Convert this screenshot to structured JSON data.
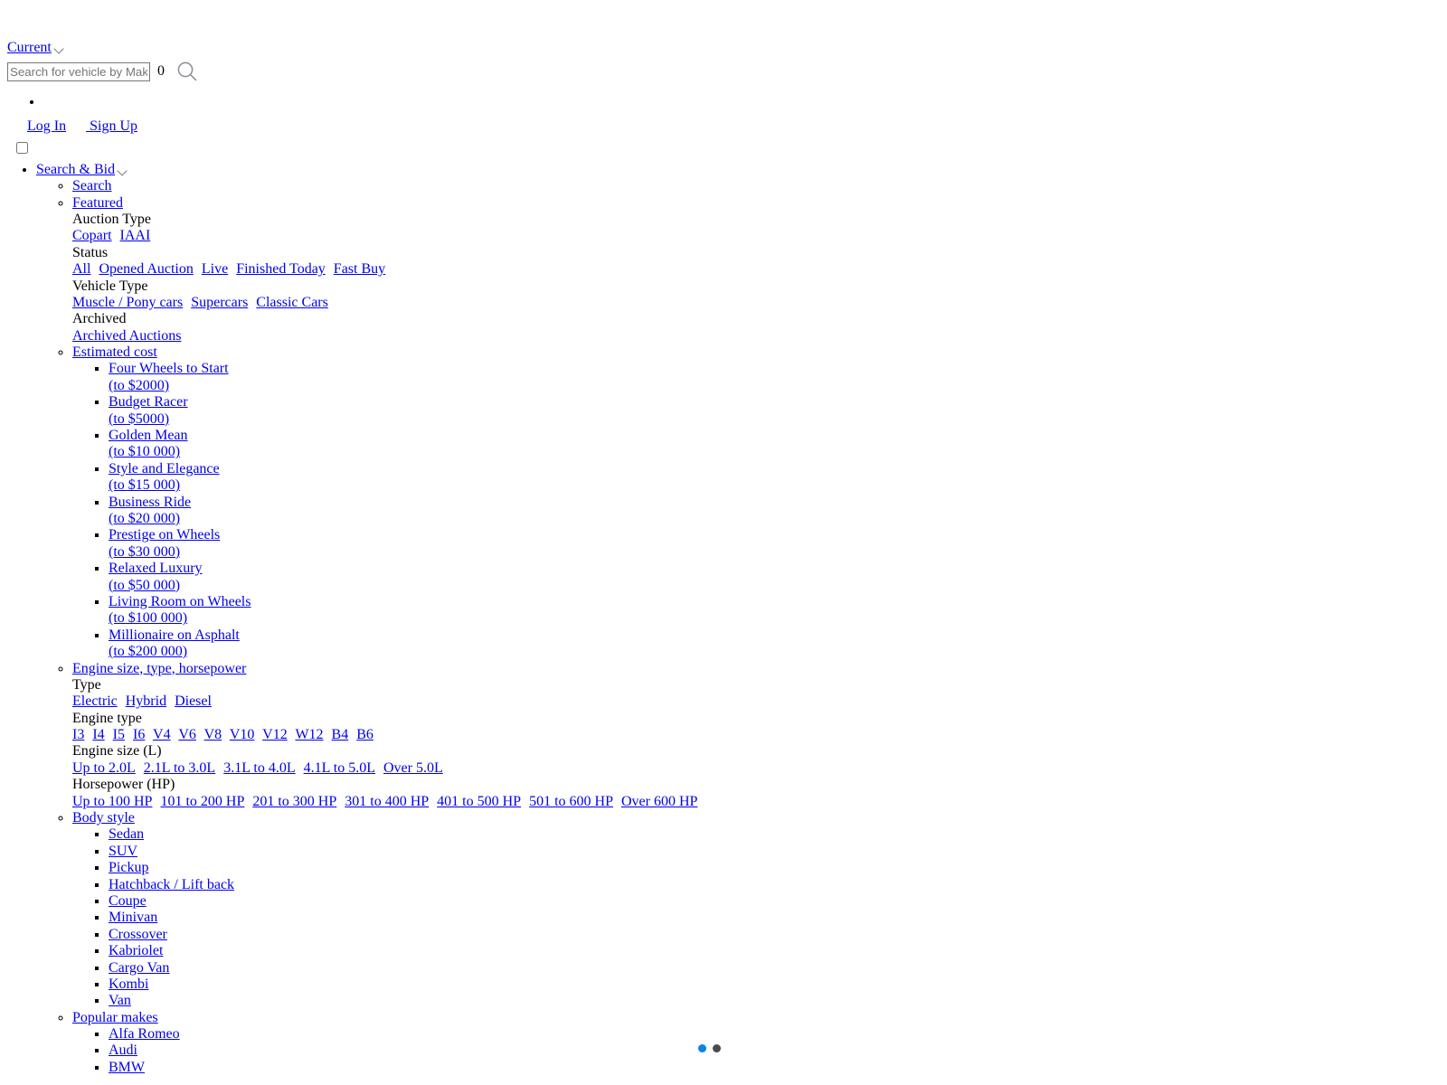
{
  "header": {
    "current_label": "Current",
    "current_chevron_icon": "chevron-down-icon",
    "search": {
      "placeholder": "Search for vehicle by Make, Model, VIN or Lot",
      "value": "",
      "count": "0",
      "icon": "search-icon"
    },
    "auth": {
      "login_label": " Log In",
      "signup_label": " Sign Up"
    },
    "menu_toggle_name": "nav-checkbox-toggle"
  },
  "nav": {
    "root_label": "Search & Bid",
    "root_chevron_icon": "chevron-down-icon",
    "items": {
      "search_label": "Search",
      "featured_label": "Featured",
      "estimated_cost_label": "Estimated cost",
      "engine_label": "Engine size, type, horsepower",
      "body_style_label": "Body style",
      "popular_makes_label": "Popular makes"
    },
    "featured": {
      "auction_type_label": "Auction Type",
      "auction_types": [
        "Copart",
        "IAAI"
      ],
      "status_label": "Status",
      "statuses": [
        "All",
        "Opened Auction",
        "Live",
        "Finished Today",
        "Fast Buy"
      ],
      "vehicle_type_label": "Vehicle Type",
      "vehicle_types": [
        "Muscle / Pony cars",
        "Supercars",
        "Classic Cars"
      ],
      "archived_label": "Archived",
      "archived_links": [
        "Archived Auctions"
      ]
    },
    "estimated_cost": [
      {
        "name": "Four Wheels to Start",
        "range": "(to $2000)"
      },
      {
        "name": "Budget Racer",
        "range": "(to $5000)"
      },
      {
        "name": "Golden Mean",
        "range": "(to $10 000)"
      },
      {
        "name": "Style and Elegance",
        "range": "(to $15 000)"
      },
      {
        "name": "Business Ride",
        "range": "(to $20 000)"
      },
      {
        "name": "Prestige on Wheels",
        "range": "(to $30 000)"
      },
      {
        "name": "Relaxed Luxury",
        "range": "(to $50 000)"
      },
      {
        "name": "Living Room on Wheels",
        "range": "(to $100 000)"
      },
      {
        "name": "Millionaire on Asphalt",
        "range": "(to $200 000)"
      }
    ],
    "engine": {
      "type_label": "Type",
      "types": [
        "Electric",
        "Hybrid",
        "Diesel"
      ],
      "engine_type_label": "Engine type",
      "engine_types": [
        "I3",
        "I4",
        "I5",
        "I6",
        "V4",
        "V6",
        "V8",
        "V10",
        "V12",
        "W12",
        "B4",
        "B6"
      ],
      "engine_size_label": "Engine size (L)",
      "engine_sizes": [
        "Up to 2.0L",
        "2.1L to 3.0L",
        "3.1L to 4.0L",
        "4.1L to 5.0L",
        "Over 5.0L"
      ],
      "horsepower_label": "Horsepower (HP)",
      "horsepowers": [
        "Up to 100 HP",
        "101 to 200 HP",
        "201 to 300 HP",
        "301 to 400 HP",
        "401 to 500 HP",
        "501 to 600 HP",
        "Over 600 HP"
      ]
    },
    "body_styles": [
      "Sedan",
      "SUV",
      "Pickup",
      "Hatchback / Lift back",
      "Coupe",
      "Minivan",
      "Crossover",
      "Kabriolet",
      "Cargo Van",
      "Kombi",
      "Van"
    ],
    "popular_makes": [
      "Alfa Romeo",
      "Audi",
      "BMW"
    ]
  },
  "carousel": {
    "dots": [
      {
        "active": true,
        "color": "#0a82e6"
      },
      {
        "active": false,
        "color": "#4a4a4a"
      }
    ]
  }
}
